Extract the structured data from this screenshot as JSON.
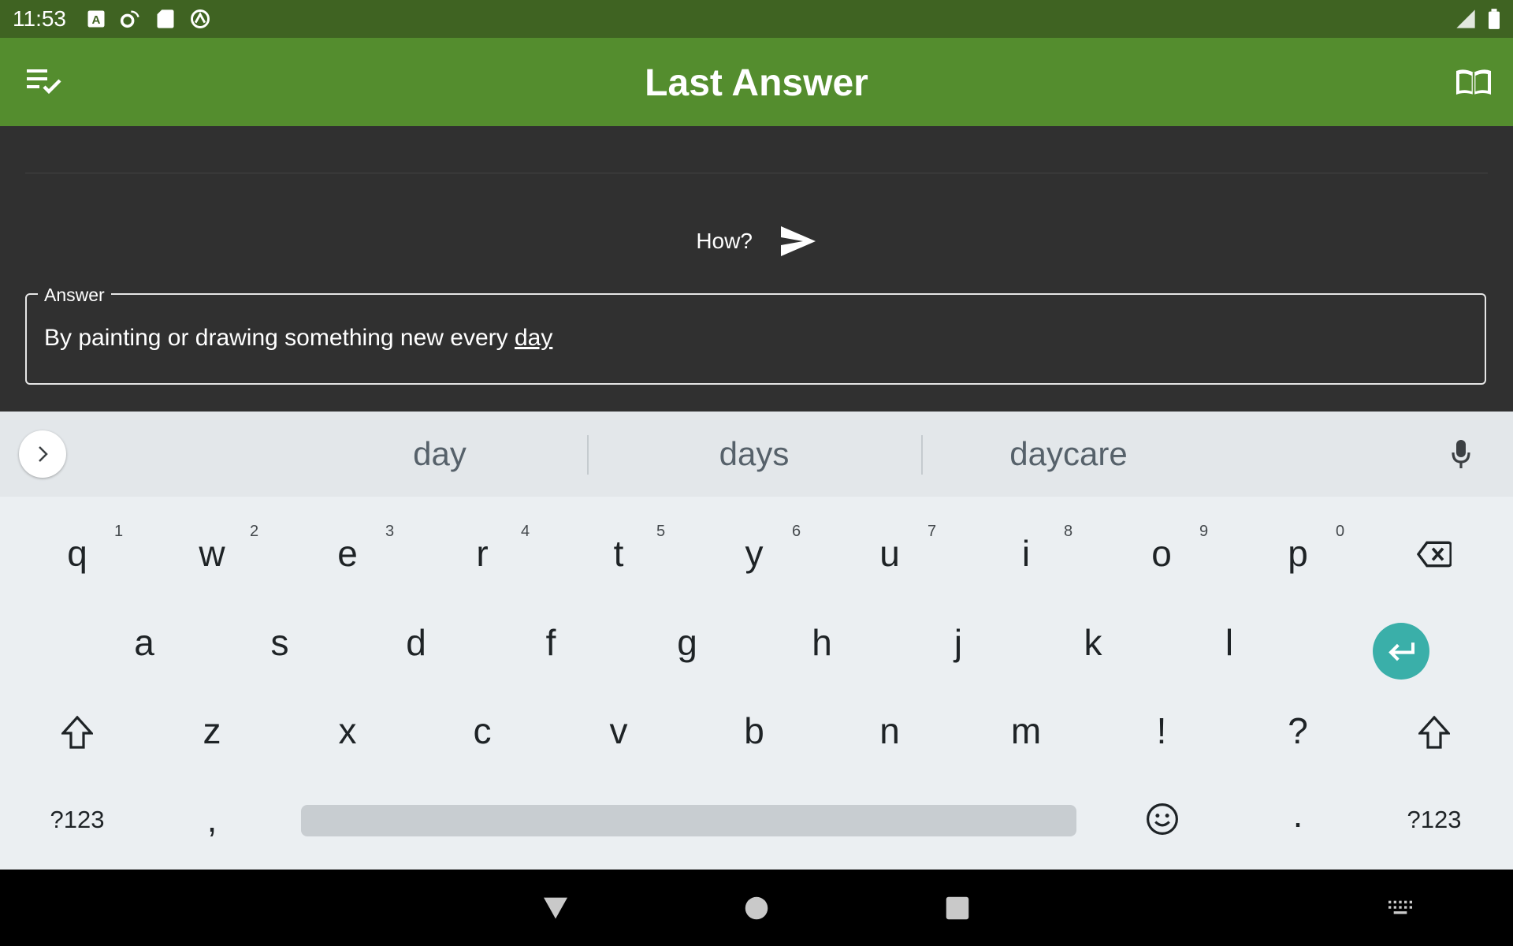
{
  "status_bar": {
    "time": "11:53",
    "icons": [
      "accessibility-a-icon",
      "settings-icon",
      "sd-card-icon",
      "sync-icon",
      "signal-icon",
      "battery-icon"
    ]
  },
  "app_bar": {
    "title": "Last Answer",
    "left_icon": "playlist-check-icon",
    "right_icon": "book-icon",
    "color": "#548d2e"
  },
  "question": {
    "text": "How?",
    "send_icon": "send-icon"
  },
  "answer": {
    "label": "Answer",
    "text_before": "By painting or drawing something new every ",
    "text_underlined": "day"
  },
  "keyboard": {
    "suggestions": [
      "day",
      "days",
      "daycare"
    ],
    "row1": [
      {
        "key": "q",
        "hint": "1"
      },
      {
        "key": "w",
        "hint": "2"
      },
      {
        "key": "e",
        "hint": "3"
      },
      {
        "key": "r",
        "hint": "4"
      },
      {
        "key": "t",
        "hint": "5"
      },
      {
        "key": "y",
        "hint": "6"
      },
      {
        "key": "u",
        "hint": "7"
      },
      {
        "key": "i",
        "hint": "8"
      },
      {
        "key": "o",
        "hint": "9"
      },
      {
        "key": "p",
        "hint": "0"
      }
    ],
    "row2": [
      "a",
      "s",
      "d",
      "f",
      "g",
      "h",
      "j",
      "k",
      "l"
    ],
    "row3": [
      "z",
      "x",
      "c",
      "v",
      "b",
      "n",
      "m",
      "!",
      "?"
    ],
    "symbols_label": "?123",
    "comma": ",",
    "period": ".",
    "enter_color": "#3aafa9"
  }
}
